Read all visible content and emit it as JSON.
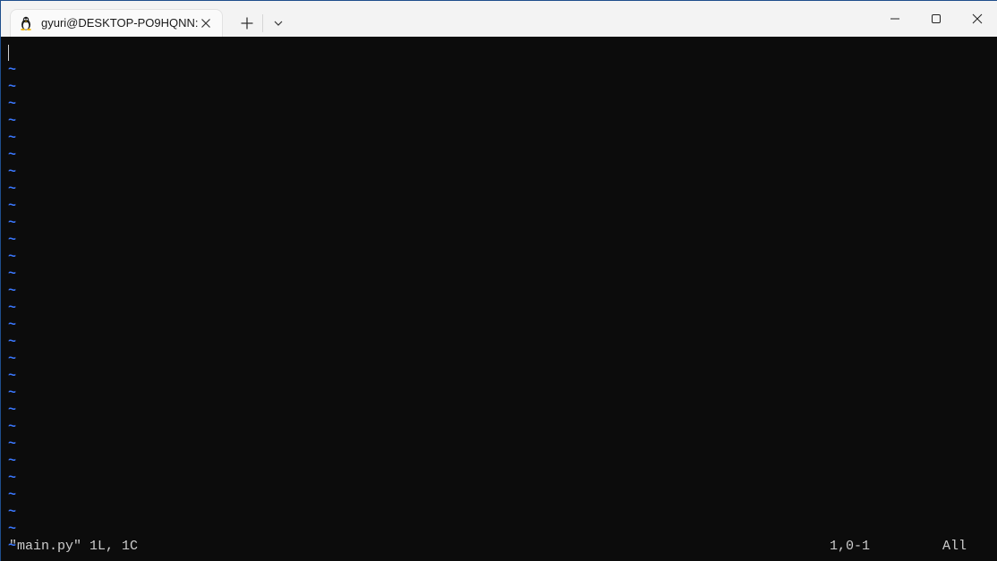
{
  "window": {
    "tab": {
      "title": "gyuri@DESKTOP-PO9HQNN: ",
      "icon": "linux-tux-icon"
    },
    "controls": {
      "new_tab_icon": "plus-icon",
      "dropdown_icon": "chevron-down-icon",
      "minimize_icon": "minimize-icon",
      "maximize_icon": "maximize-icon",
      "close_icon": "close-icon"
    }
  },
  "editor": {
    "empty_line_marker": "~",
    "empty_line_count": 29,
    "status": {
      "file": "\"main.py\" 1L, 1C",
      "position": "1,0-1",
      "scroll": "All"
    }
  },
  "colors": {
    "terminal_bg": "#0c0c0c",
    "tilde": "#3b78ff",
    "status_text": "#cccccc",
    "titlebar_bg": "#f3f3f3"
  }
}
